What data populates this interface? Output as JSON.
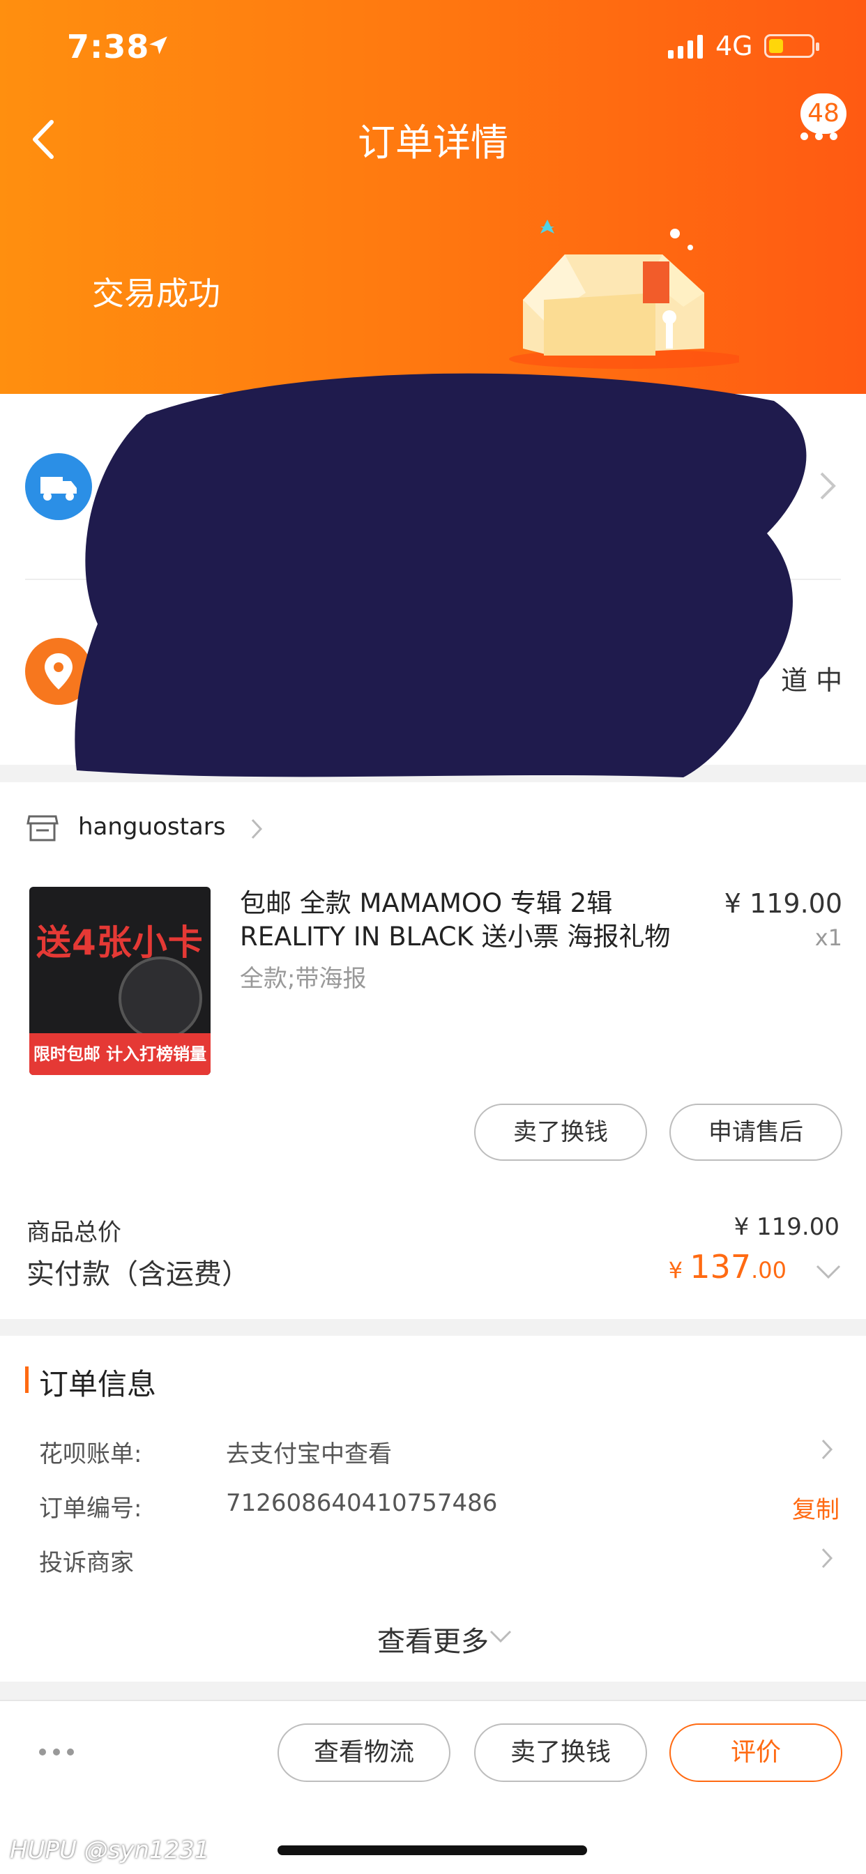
{
  "status_bar": {
    "time": "7:38",
    "network": "4G",
    "location_icon": "location-arrow-icon",
    "signal_icon": "signal-bars-icon",
    "battery_icon": "battery-low-icon",
    "battery_level": 0.35
  },
  "nav": {
    "title": "订单详情",
    "back_icon": "chevron-left-icon",
    "more_icon": "more-dots-icon",
    "badge": "48"
  },
  "order_status": {
    "text": "交易成功",
    "illustration": "open-box-illustration"
  },
  "colors": {
    "header_gradient_start": "#ff8f0f",
    "header_gradient_end": "#ff5a12",
    "accent": "#ff6a12",
    "truck_icon_bg": "#2b8fe6",
    "pin_icon_bg": "#f7771e",
    "redaction": "#1f1b4d"
  },
  "shipping": {
    "truck_icon": "truck-icon",
    "address_icon": "location-pin-icon",
    "partial_address": "道 中",
    "redacted": true
  },
  "shop": {
    "icon": "store-icon",
    "name": "hanguostars"
  },
  "product": {
    "title": "包邮 全款  MAMAMOO 专辑 2辑 REALITY IN BLACK 送小票 海报礼物",
    "spec": "全款;带海报",
    "price": "¥ 119.00",
    "qty": "x1",
    "thumb_headline": "送4张小卡",
    "thumb_banner": "限时包邮 计入打榜销量",
    "actions": {
      "sell": "卖了换钱",
      "after_sale": "申请售后"
    }
  },
  "totals": {
    "goods_total_label": "商品总价",
    "goods_total_value": "¥ 119.00",
    "paid_label": "实付款（含运费）",
    "paid_currency": "¥",
    "paid_integer": "137",
    "paid_decimal": ".00"
  },
  "order_info": {
    "title": "订单信息",
    "huabei_label": "花呗账单:",
    "huabei_value": "去支付宝中查看",
    "order_no_label": "订单编号:",
    "order_no_value": "712608640410757486",
    "copy_label": "复制",
    "complaint_label": "投诉商家",
    "see_more": "查看更多"
  },
  "bottom_bar": {
    "logistics": "查看物流",
    "sell": "卖了换钱",
    "review": "评价"
  },
  "watermark": "HUPU @syn1231"
}
